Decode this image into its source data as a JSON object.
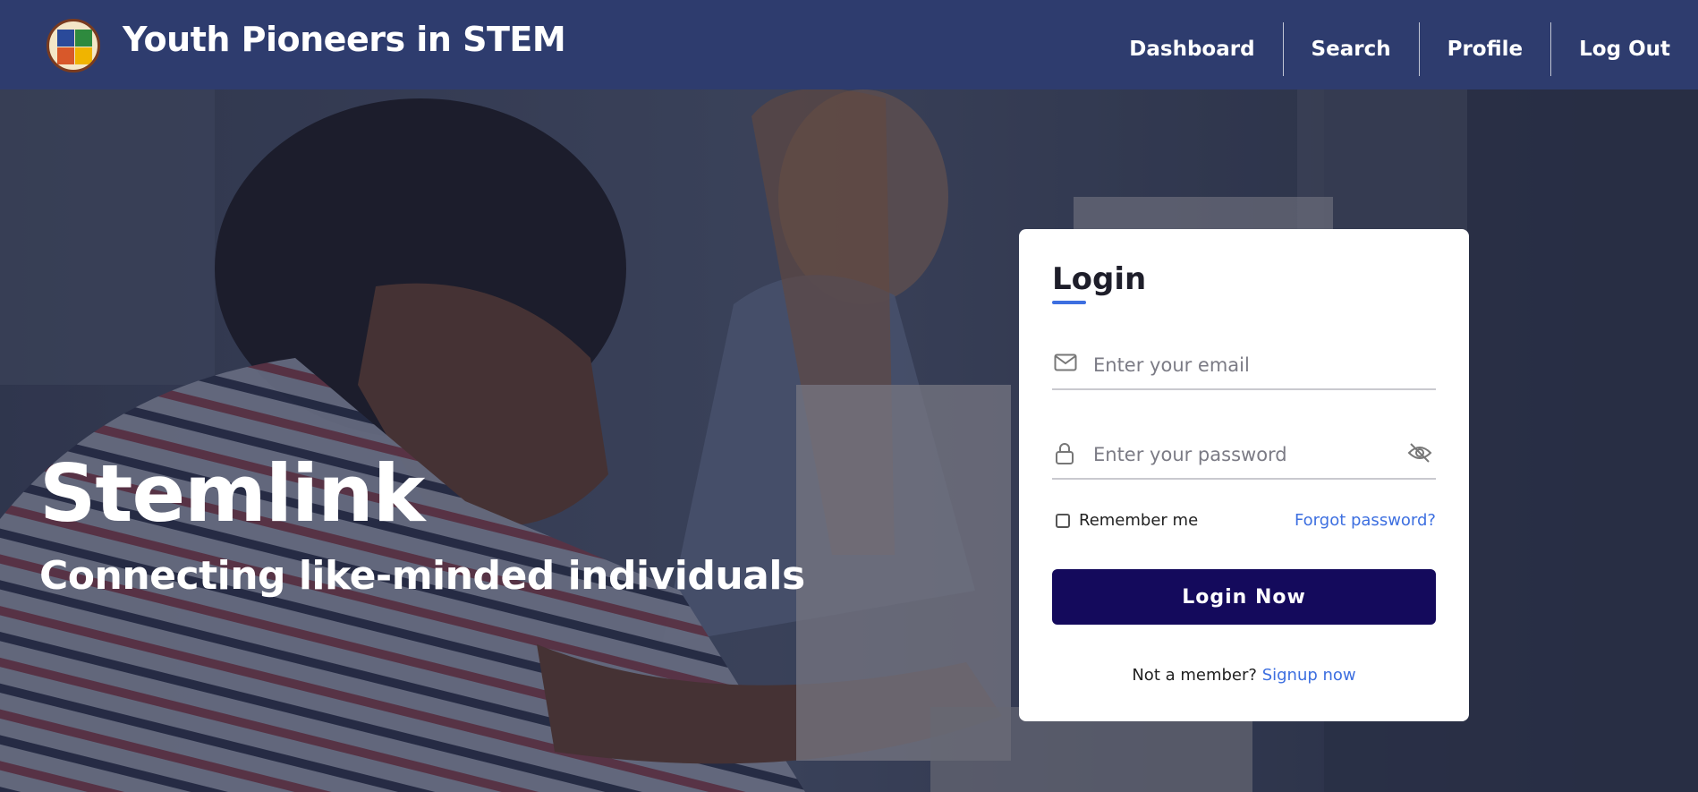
{
  "header": {
    "brand_title": "Youth Pioneers in STEM",
    "nav": [
      {
        "label": "Dashboard"
      },
      {
        "label": "Search"
      },
      {
        "label": "Profile"
      },
      {
        "label": "Log Out"
      }
    ]
  },
  "hero": {
    "title": "Stemlink",
    "subtitle": "Connecting like-minded individuals"
  },
  "login": {
    "title": "Login",
    "email_placeholder": "Enter your email",
    "password_placeholder": "Enter your password",
    "remember_label": "Remember me",
    "forgot_label": "Forgot password?",
    "submit_label": "Login Now",
    "signup_prompt": "Not a member?",
    "signup_link": "Signup now"
  },
  "icons": {
    "email": "mail-icon",
    "password": "lock-icon",
    "toggle": "eye-slash-icon",
    "logo": "logo-emblem"
  },
  "colors": {
    "navbar": "#2e3c6e",
    "accent": "#3d6fe0",
    "button": "#140a5c"
  }
}
